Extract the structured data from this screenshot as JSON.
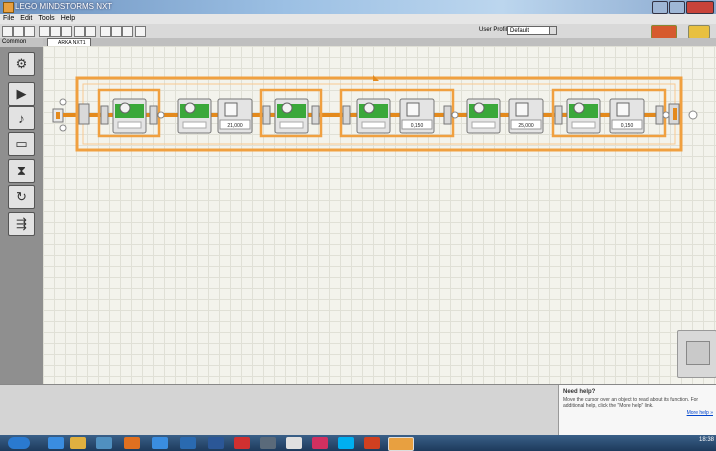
{
  "window": {
    "title": "LEGO MINDSTORMS NXT"
  },
  "menu": {
    "items": [
      "File",
      "Edit",
      "Tools",
      "Help"
    ]
  },
  "toolbar": {
    "profile_label": "User Profile:",
    "profile_value": "Default"
  },
  "palette": {
    "header": "Common"
  },
  "tab": {
    "name": "ARKA NXT1"
  },
  "program": {
    "wait_values": [
      "21,000",
      "0,150",
      "25,000",
      "0,150"
    ]
  },
  "help": {
    "title": "Need help?",
    "text": "Move the cursor over an object to read about its function. For additional help, click the \"More help\" link.",
    "link": "More help »"
  },
  "taskbar": {
    "clock_time": "18:38"
  }
}
